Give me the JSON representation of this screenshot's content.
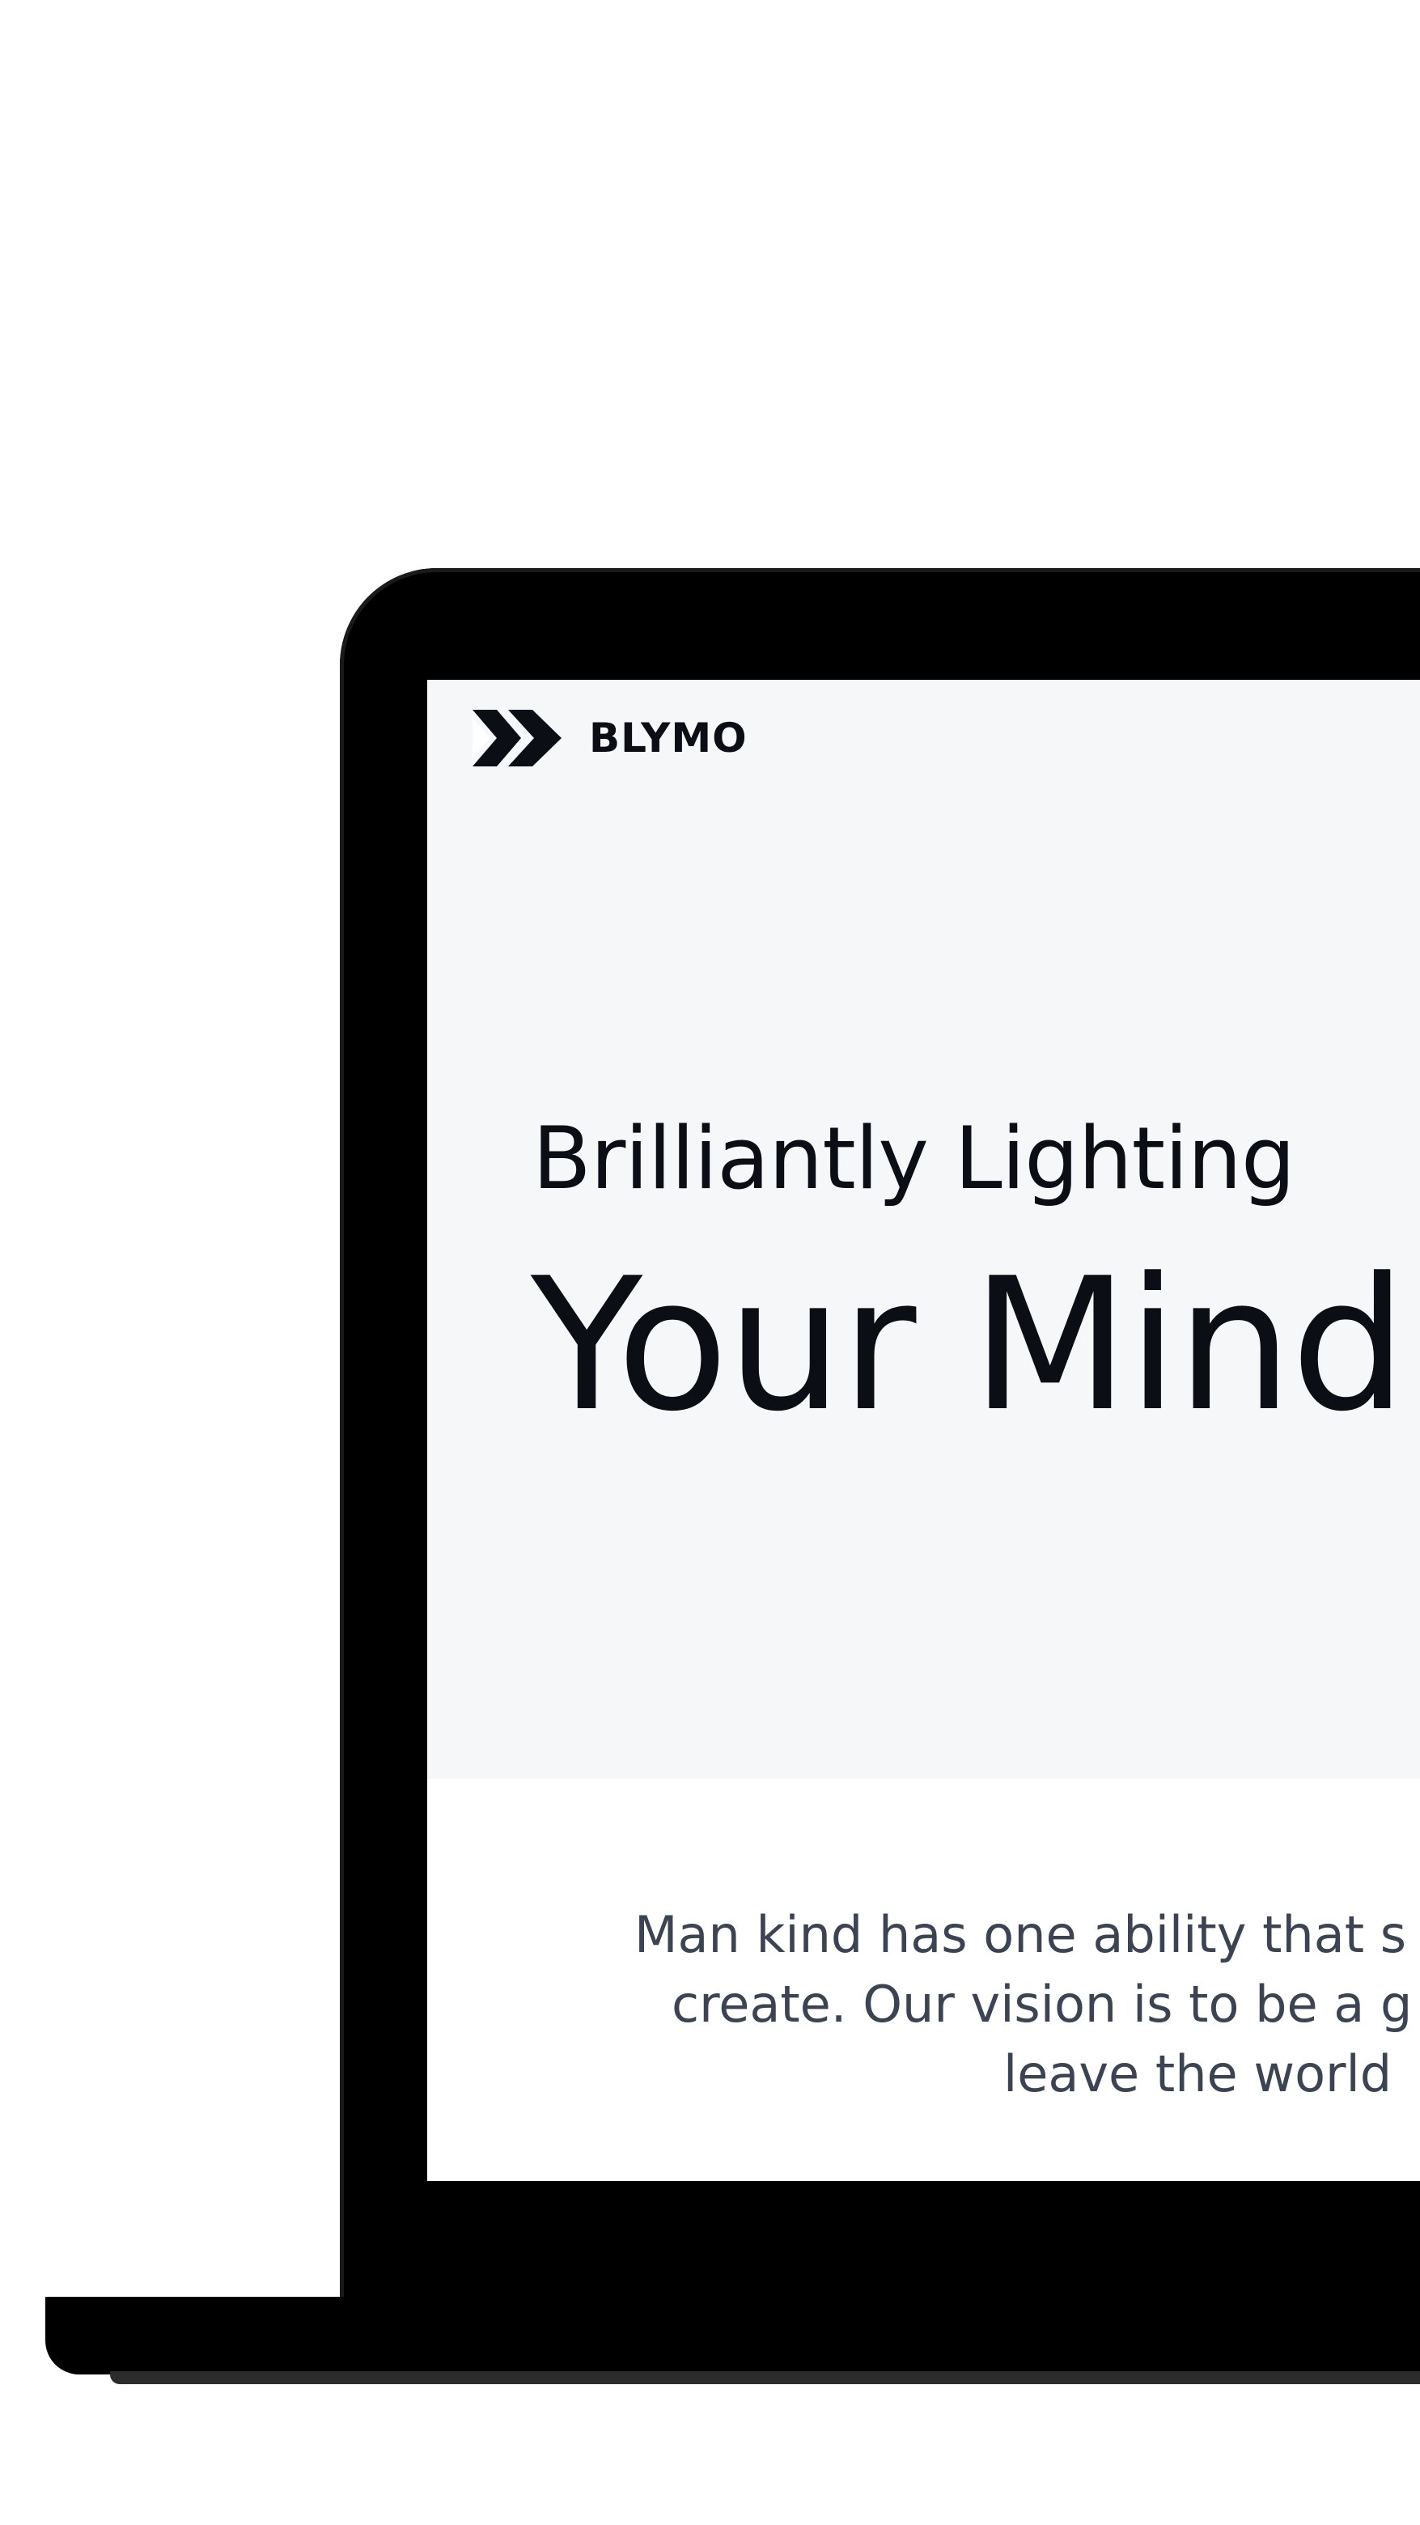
{
  "site": {
    "brand_name": "BLYMO",
    "logo_icon": "double-chevron-arrow-icon"
  },
  "hero": {
    "subheadline": "Brilliantly Lighting",
    "headline": "Your Mind's"
  },
  "vision": {
    "lines": [
      "Man kind has one ability that s",
      "create. Our vision is to be a g",
      "leave the world"
    ]
  },
  "colors": {
    "hero_background": "#f6f7f9",
    "headline_text": "#0b0e14",
    "body_text": "#3c4352",
    "device_frame": "#000000"
  }
}
